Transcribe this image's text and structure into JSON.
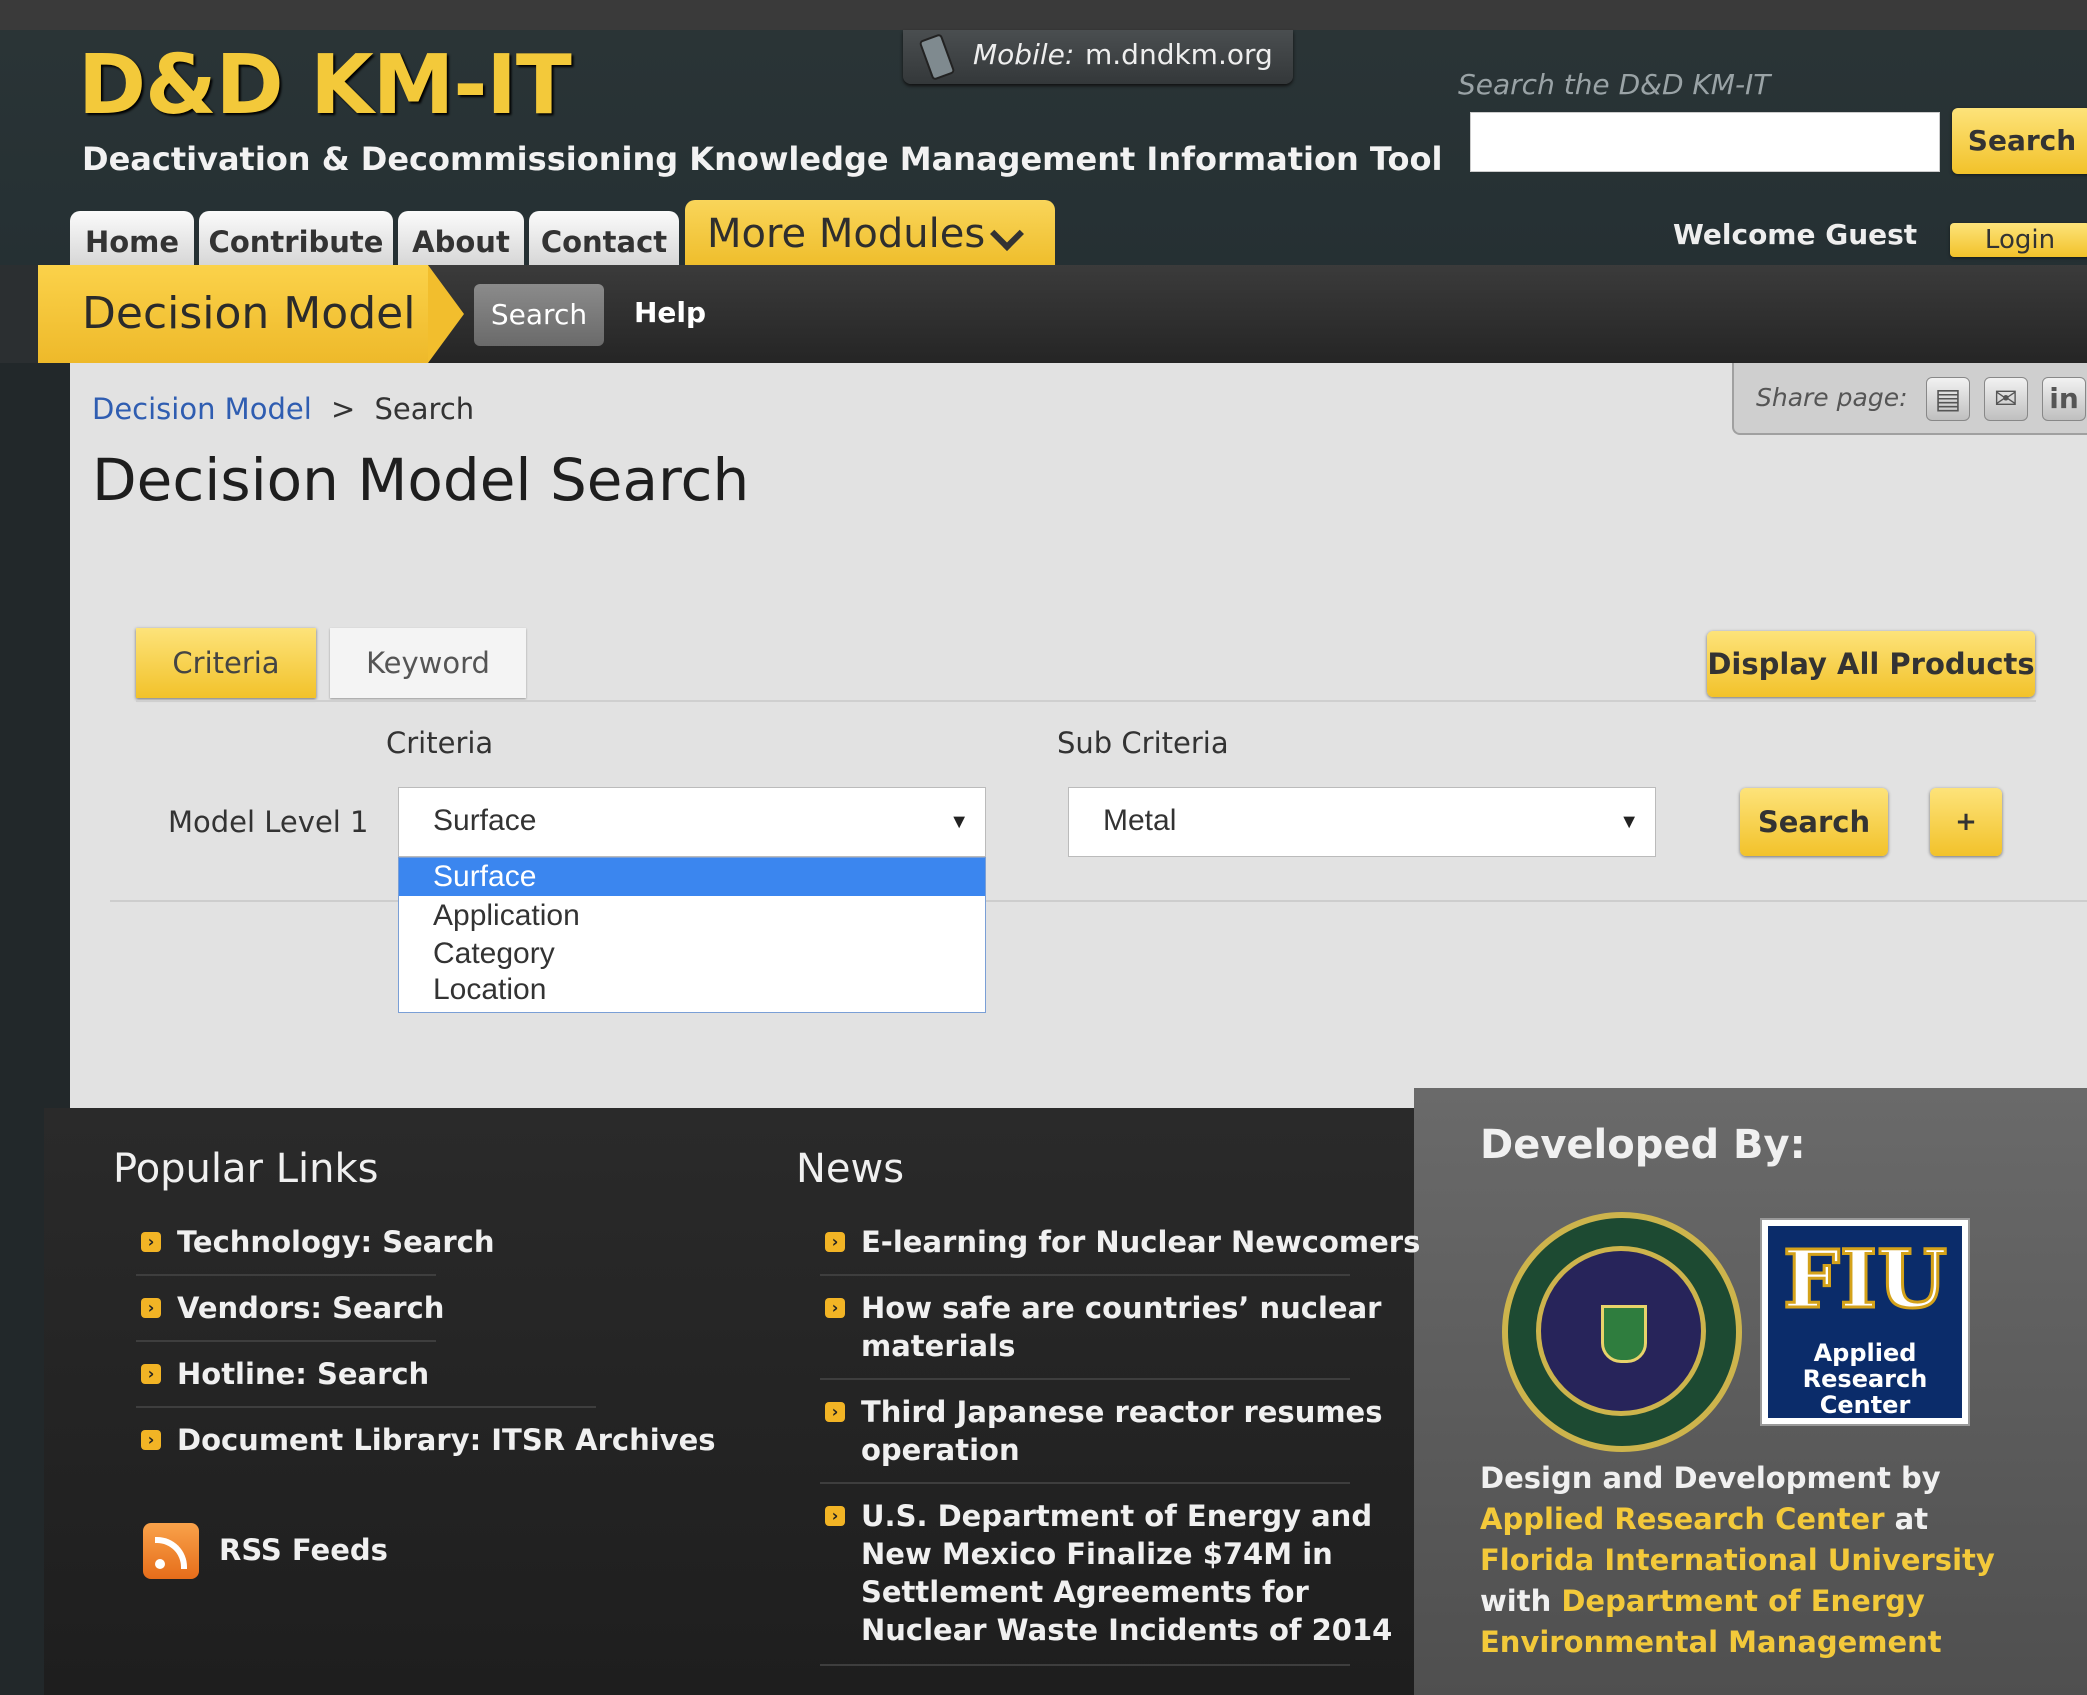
{
  "header": {
    "logo_text": "D&D KM-IT",
    "tagline": "Deactivation & Decommissioning Knowledge Management Information Tool",
    "mobile_label": "Mobile:",
    "mobile_url": "m.dndkm.org",
    "search_hint": "Search the D&D KM-IT",
    "search_value": "",
    "search_button": "Search",
    "welcome_text": "Welcome Guest",
    "login_button": "Login"
  },
  "nav": {
    "tabs": [
      "Home",
      "Contribute",
      "About",
      "Contact"
    ],
    "more_modules": "More Modules"
  },
  "module_bar": {
    "title": "Decision Model",
    "search_label": "Search",
    "help_label": "Help"
  },
  "share": {
    "label": "Share page:",
    "icons": [
      "print-icon",
      "email-icon",
      "linkedin-icon"
    ],
    "linkedin_glyph": "in"
  },
  "breadcrumb": {
    "parent": "Decision Model",
    "separator": ">",
    "current": "Search"
  },
  "page_title": "Decision Model Search",
  "search_tabs": {
    "criteria": "Criteria",
    "keyword": "Keyword",
    "active": "Criteria"
  },
  "display_all_button": "Display All Products",
  "form": {
    "criteria_header": "Criteria",
    "sub_criteria_header": "Sub Criteria",
    "row_label": "Model Level 1",
    "criteria_value": "Surface",
    "sub_criteria_value": "Metal",
    "search_button": "Search",
    "add_button": "+",
    "dropdown_options": [
      "Surface",
      "Application",
      "Category",
      "Location"
    ],
    "dropdown_selected": "Surface"
  },
  "footer": {
    "popular_links_title": "Popular Links",
    "popular_links": [
      "Technology: Search",
      "Vendors: Search",
      "Hotline: Search",
      "Document Library: ITSR Archives"
    ],
    "rss_label": "RSS Feeds",
    "news_title": "News",
    "news": [
      [
        "E-learning for Nuclear Newcomers"
      ],
      [
        "How safe are countries’ nuclear",
        "materials"
      ],
      [
        "Third Japanese reactor resumes",
        "operation"
      ],
      [
        "U.S. Department of Energy and",
        "New Mexico Finalize $74M in",
        "Settlement Agreements for",
        "Nuclear Waste Incidents of 2014"
      ]
    ],
    "developed_by_title": "Developed By:",
    "fiu_logo_text": "FIU",
    "fiu_logo_subtext": "Applied Research Center",
    "dev_text": {
      "p1": "Design and Development by ",
      "l1": "Applied Research Center",
      "p2": " at ",
      "l2": "Florida International University",
      "p3": " with ",
      "l3": "Department of Energy Environmental Management"
    }
  },
  "colors": {
    "accent_yellow": "#f2c22a",
    "link_blue": "#2f5db1",
    "dropdown_highlight": "#3b86ef"
  }
}
